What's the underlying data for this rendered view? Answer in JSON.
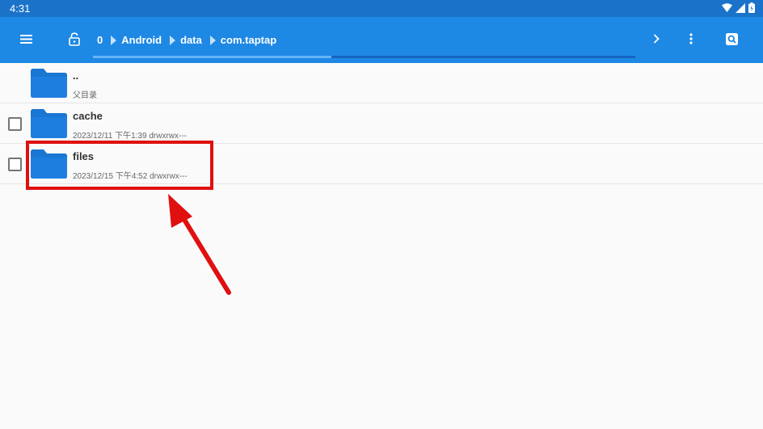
{
  "status_bar": {
    "time": "4:31",
    "icons": [
      "wifi-icon",
      "signal-icon",
      "battery-icon"
    ]
  },
  "app_bar": {
    "menu_icon": "hamburger-menu-icon",
    "lock_icon": "lock-icon",
    "breadcrumb": [
      "0",
      "Android",
      "data",
      "com.taptap"
    ],
    "forward_icon": "chevron-right-icon",
    "more_icon": "more-vert-icon",
    "search_icon": "search-icon",
    "progress_fraction": 0.44
  },
  "files": [
    {
      "name": "..",
      "meta": "父目录",
      "has_checkbox": false
    },
    {
      "name": "cache",
      "meta": "2023/12/11 下午1:39   drwxrwx---",
      "has_checkbox": true
    },
    {
      "name": "files",
      "meta": "2023/12/15 下午4:52   drwxrwx---",
      "has_checkbox": true
    }
  ],
  "colors": {
    "status_bar": "#1a73c9",
    "app_bar": "#1e88e5",
    "folder": "#1976d2",
    "annotation": "#e01010"
  }
}
